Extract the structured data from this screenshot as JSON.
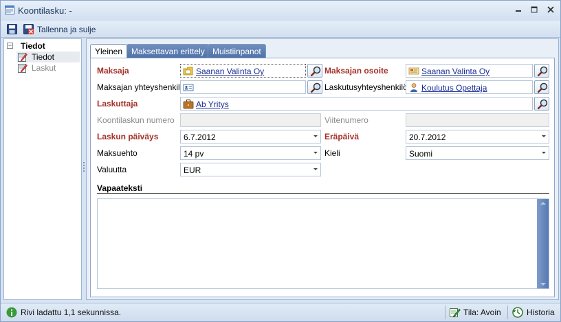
{
  "window": {
    "title": "Koontilasku:  -"
  },
  "toolbar": {
    "save_close_label": "Tallenna ja sulje"
  },
  "tree": {
    "root_label": "Tiedot",
    "items": [
      {
        "label": "Tiedot",
        "selected": true
      },
      {
        "label": "Laskut",
        "selected": false
      }
    ]
  },
  "tabs": [
    {
      "label": "Yleinen",
      "active": true
    },
    {
      "label": "Maksettavan erittely",
      "active": false
    },
    {
      "label": "Muistiinpanot",
      "active": false
    }
  ],
  "form": {
    "maksaja": {
      "label": "Maksaja",
      "value": "Saanan Valinta Oy"
    },
    "maksajan_osoite": {
      "label": "Maksajan osoite",
      "value": "Saanan Valinta Oy"
    },
    "maksajan_yhteyshenkilo": {
      "label": "Maksajan yhteyshenkilö",
      "value": ""
    },
    "laskutusyhteyshenkilo": {
      "label": "Laskutusyhteyshenkilö",
      "value": "Koulutus Opettaja"
    },
    "laskuttaja": {
      "label": "Laskuttaja",
      "value": "Ab Yritys"
    },
    "koontilaskun_numero": {
      "label": "Koontilaskun numero",
      "value": ""
    },
    "viitenumero": {
      "label": "Viitenumero",
      "value": ""
    },
    "laskun_paivays": {
      "label": "Laskun päiväys",
      "value": "6.7.2012"
    },
    "erapaiva": {
      "label": "Eräpäivä",
      "value": "20.7.2012"
    },
    "maksuehto": {
      "label": "Maksuehto",
      "value": "14 pv"
    },
    "kieli": {
      "label": "Kieli",
      "value": "Suomi"
    },
    "valuutta": {
      "label": "Valuutta",
      "value": "EUR"
    },
    "vapaateksti": {
      "label": "Vapaateksti",
      "value": ""
    }
  },
  "status": {
    "message": "Rivi ladattu 1,1 sekunnissa.",
    "state_label": "Tila: Avoin",
    "history_label": "Historia"
  },
  "colors": {
    "required_label": "#a3312a",
    "link": "#1a2d96",
    "tab_inactive": "#5677ad"
  }
}
